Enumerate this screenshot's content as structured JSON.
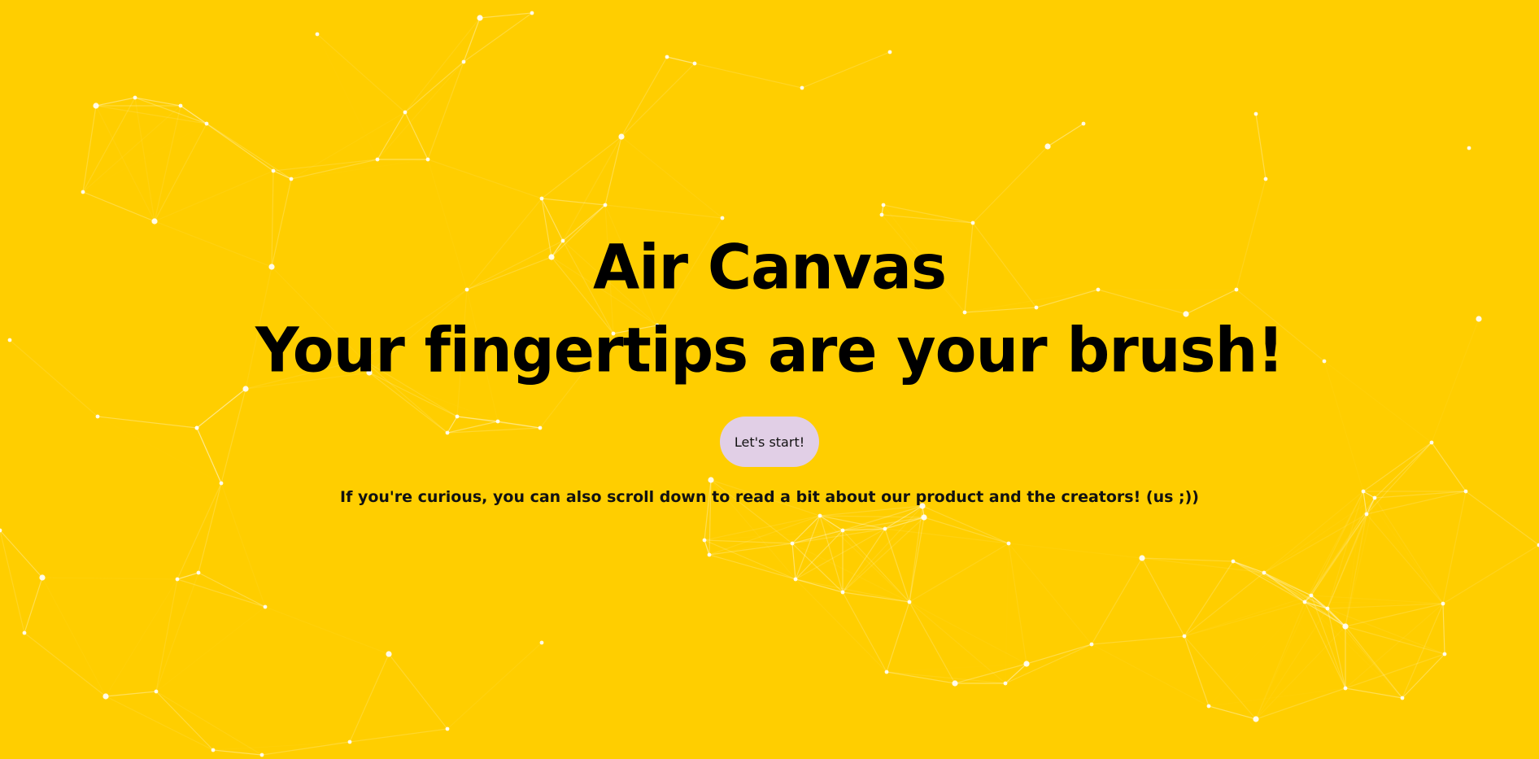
{
  "hero": {
    "title_line1": "Air Canvas",
    "title_line2": "Your fingertips are your brush!",
    "start_button": "Let's start!",
    "curious_text": "If you're curious, you can also scroll down to read a bit about our product and the creators! (us ;))"
  },
  "colors": {
    "background": "#FFCE00",
    "button": "#E1CFE6",
    "text": "#000000",
    "network": "#FFFFFF"
  }
}
